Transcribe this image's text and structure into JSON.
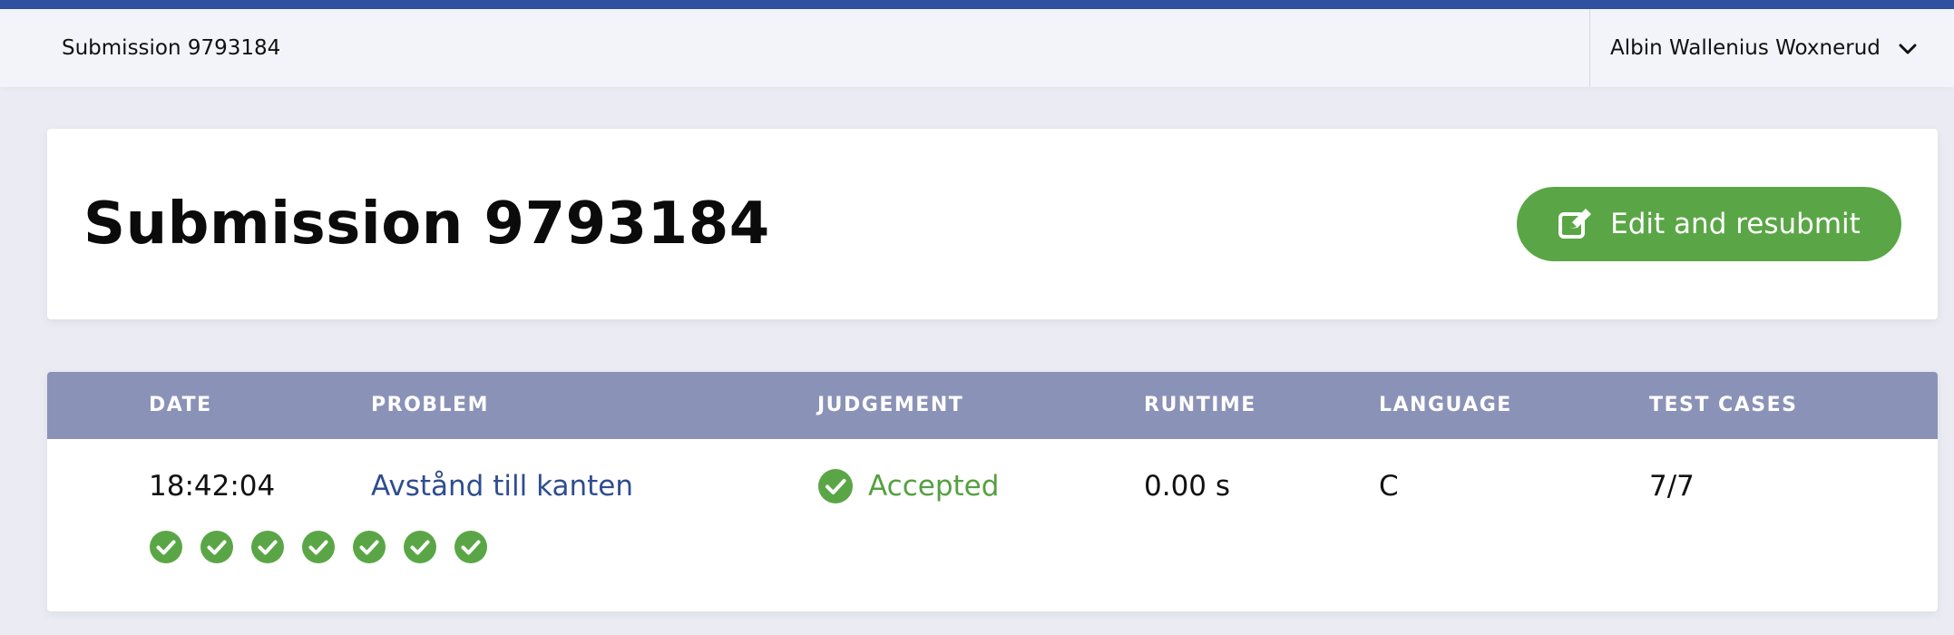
{
  "colors": {
    "accent": "#2f52a0",
    "success": "#5aa646",
    "link": "#2f4d8f",
    "table_header": "#8b92b7"
  },
  "topbar": {
    "breadcrumb": "Submission 9793184",
    "user_name": "Albin Wallenius Woxnerud",
    "user_menu_icon": "chevron-down-icon"
  },
  "header_card": {
    "title": "Submission 9793184",
    "resubmit_label": "Edit and resubmit",
    "resubmit_icon": "edit-icon"
  },
  "table": {
    "columns": [
      "DATE",
      "PROBLEM",
      "JUDGEMENT",
      "RUNTIME",
      "LANGUAGE",
      "TEST CASES"
    ],
    "row": {
      "date": "18:42:04",
      "problem": "Avstånd till kanten",
      "judgement": "Accepted",
      "judgement_icon": "check-circle-icon",
      "runtime": "0.00 s",
      "language": "C",
      "test_cases": "7/7"
    },
    "test_case_results": [
      "accepted",
      "accepted",
      "accepted",
      "accepted",
      "accepted",
      "accepted",
      "accepted"
    ]
  }
}
